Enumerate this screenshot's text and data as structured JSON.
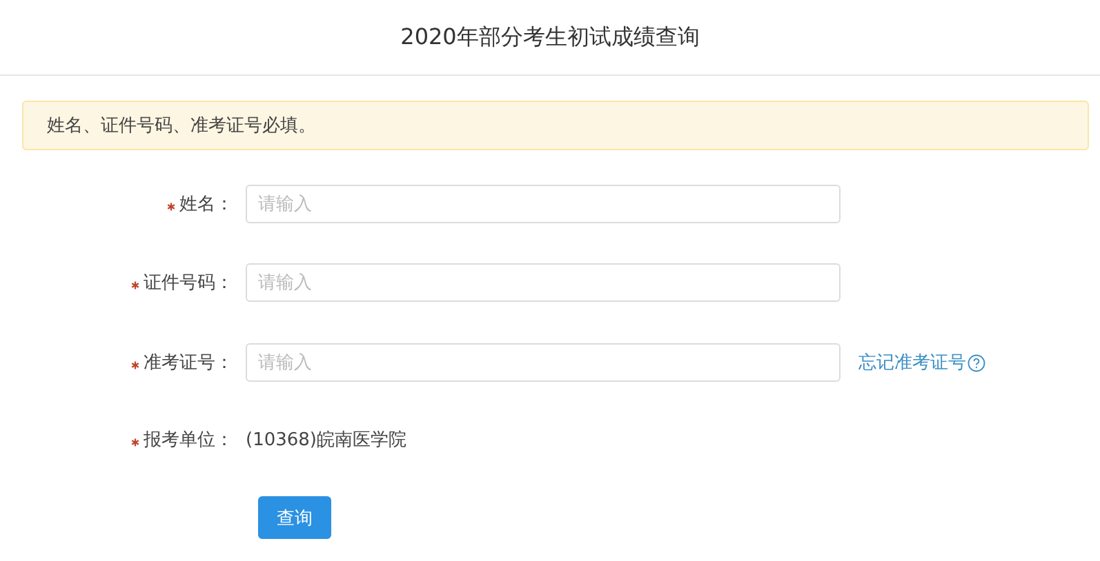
{
  "header": {
    "title": "2020年部分考生初试成绩查询"
  },
  "notice": {
    "text": "姓名、证件号码、准考证号必填。"
  },
  "form": {
    "fields": [
      {
        "kind": "input",
        "label": "姓名：",
        "required": true,
        "placeholder": "请输入"
      },
      {
        "kind": "input",
        "label": "证件号码：",
        "required": true,
        "placeholder": "请输入"
      },
      {
        "kind": "input",
        "label": "准考证号：",
        "required": true,
        "placeholder": "请输入",
        "link": "忘记准考证号"
      },
      {
        "kind": "text",
        "label": "报考单位：",
        "required": true,
        "value": "(10368)皖南医学院"
      }
    ],
    "submit": "查询"
  }
}
